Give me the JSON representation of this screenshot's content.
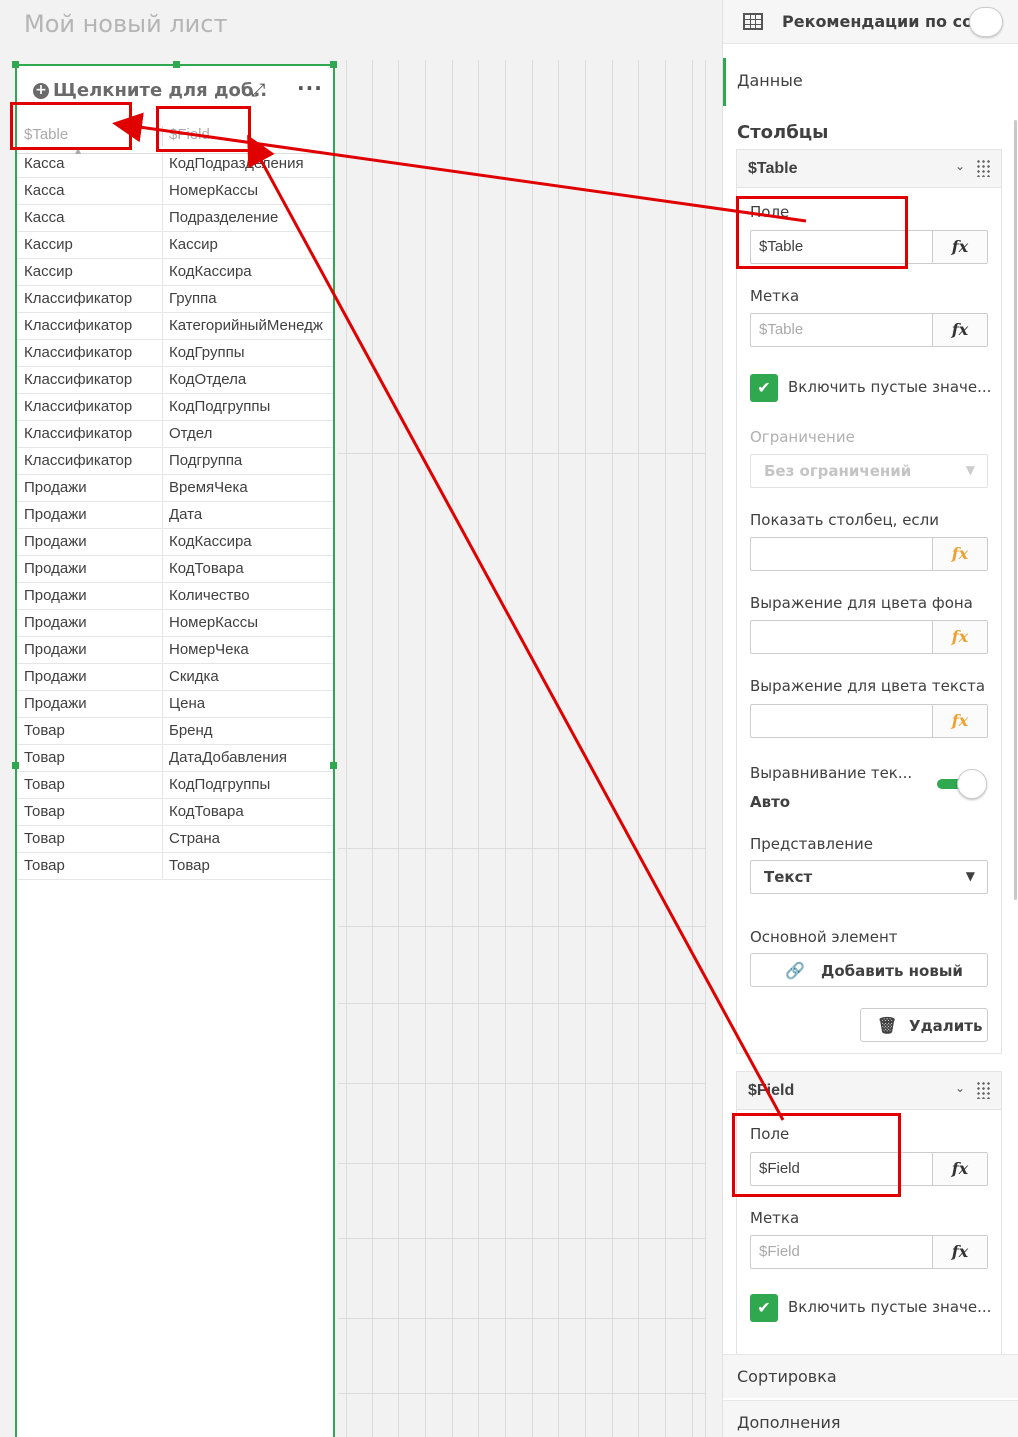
{
  "sheet_title": "Мой новый лист",
  "object": {
    "title": "Щелкните для доб..",
    "headers": [
      "$Table",
      "$Field"
    ],
    "rows": [
      [
        "Касса",
        "КодПодразделения"
      ],
      [
        "Касса",
        "НомерКассы"
      ],
      [
        "Касса",
        "Подразделение"
      ],
      [
        "Кассир",
        "Кассир"
      ],
      [
        "Кассир",
        "КодКассира"
      ],
      [
        "Классификатор",
        "Группа"
      ],
      [
        "Классификатор",
        "КатегорийныйМенедж"
      ],
      [
        "Классификатор",
        "КодГруппы"
      ],
      [
        "Классификатор",
        "КодОтдела"
      ],
      [
        "Классификатор",
        "КодПодгруппы"
      ],
      [
        "Классификатор",
        "Отдел"
      ],
      [
        "Классификатор",
        "Подгруппа"
      ],
      [
        "Продажи",
        "ВремяЧека"
      ],
      [
        "Продажи",
        "Дата"
      ],
      [
        "Продажи",
        "КодКассира"
      ],
      [
        "Продажи",
        "КодТовара"
      ],
      [
        "Продажи",
        "Количество"
      ],
      [
        "Продажи",
        "НомерКассы"
      ],
      [
        "Продажи",
        "НомерЧека"
      ],
      [
        "Продажи",
        "Скидка"
      ],
      [
        "Продажи",
        "Цена"
      ],
      [
        "Товар",
        "Бренд"
      ],
      [
        "Товар",
        "ДатаДобавления"
      ],
      [
        "Товар",
        "КодПодгруппы"
      ],
      [
        "Товар",
        "КодТовара"
      ],
      [
        "Товар",
        "Страна"
      ],
      [
        "Товар",
        "Товар"
      ]
    ]
  },
  "panel": {
    "top_title": "Рекомендации по соз...",
    "tab_data": "Данные",
    "section_columns": "Столбцы",
    "col1": {
      "name": "$Table",
      "field_label": "Поле",
      "field_value": "$Table",
      "label_label": "Метка",
      "label_placeholder": "$Table",
      "include_empty": "Включить пустые значе...",
      "limit_label": "Ограничение",
      "limit_value": "Без ограничений",
      "show_if_label": "Показать столбец, если",
      "bg_expr_label": "Выражение для цвета фона",
      "text_expr_label": "Выражение для цвета текста",
      "align_label": "Выравнивание тек...",
      "align_value": "Авто",
      "representation_label": "Представление",
      "representation_value": "Текст",
      "master_label": "Основной элемент",
      "add_new": "Добавить новый",
      "delete": "Удалить"
    },
    "col2": {
      "name": "$Field",
      "field_label": "Поле",
      "field_value": "$Field",
      "label_label": "Метка",
      "label_placeholder": "$Field",
      "include_empty": "Включить пустые значе..."
    },
    "fx": "fx",
    "sorting": "Сортировка",
    "addons": "Дополнения"
  },
  "colors": {
    "selection_green": "#2fa84f",
    "annotation_red": "#e00000",
    "fx_orange": "#f0a030"
  }
}
